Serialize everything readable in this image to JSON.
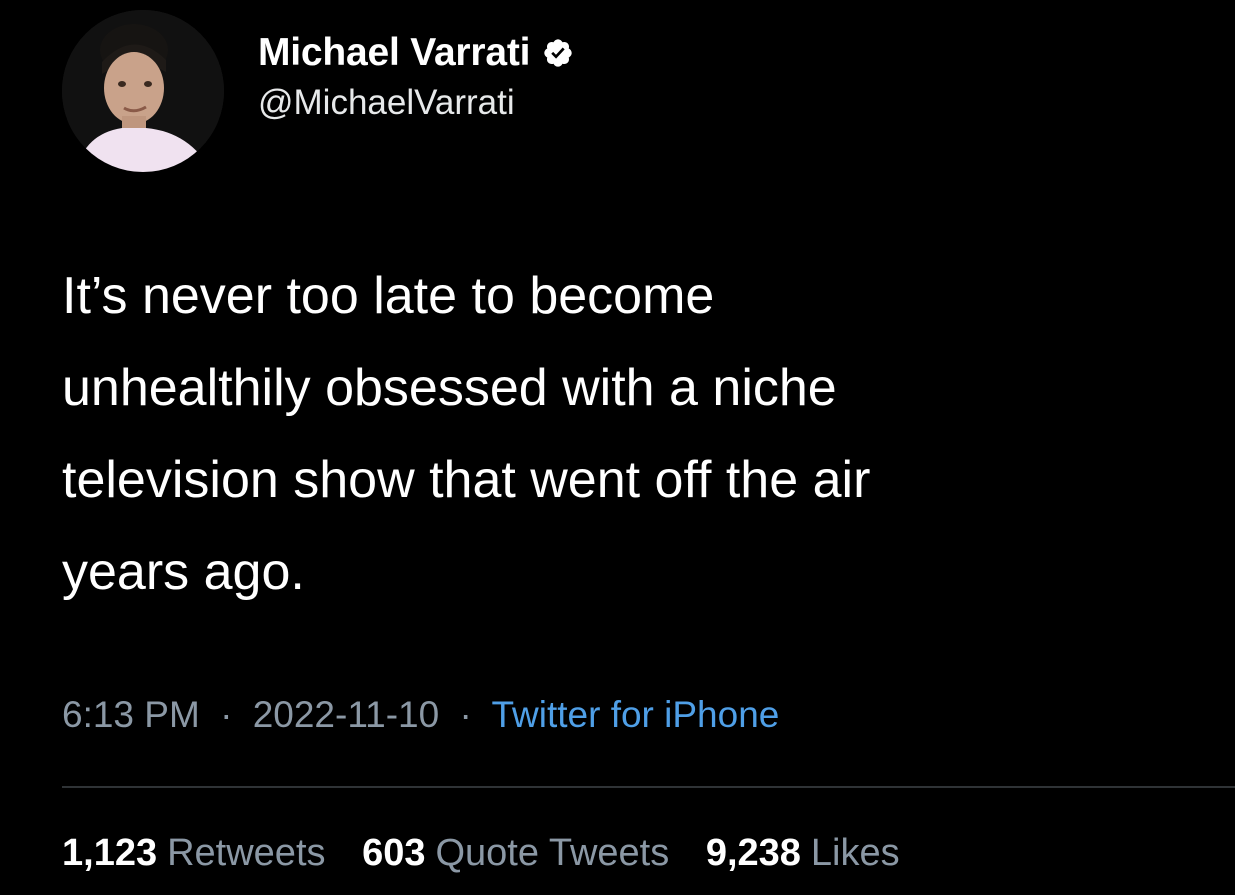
{
  "user": {
    "display_name": "Michael Varrati",
    "handle": "@MichaelVarrati",
    "verified": true,
    "avatar_icon": "profile-photo"
  },
  "tweet": {
    "text": "It’s never too late to become\nunhealthily obsessed with a niche\ntelevision show that went off the air\nyears ago."
  },
  "meta": {
    "time": "6:13 PM",
    "separator": "·",
    "date": "2022-11-10",
    "source": "Twitter for iPhone"
  },
  "stats": {
    "retweets": {
      "count": "1,123",
      "label": "Retweets"
    },
    "quote_tweets": {
      "count": "603",
      "label": "Quote Tweets"
    },
    "likes": {
      "count": "9,238",
      "label": "Likes"
    }
  },
  "colors": {
    "background": "#000000",
    "text": "#ffffff",
    "muted": "#8b98a5",
    "link": "#4f9fe7",
    "divider": "#2f3336"
  }
}
